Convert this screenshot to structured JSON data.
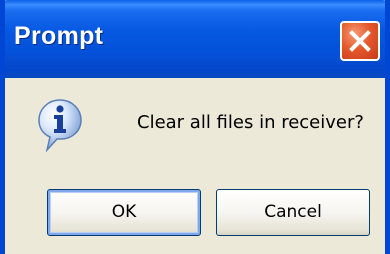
{
  "window": {
    "title": "Prompt",
    "close_icon": "close-icon"
  },
  "dialog": {
    "icon": "info-icon",
    "message": "Clear all files in receiver?",
    "ok_label": "OK",
    "cancel_label": "Cancel"
  },
  "colors": {
    "titlebar": "#0558e0",
    "frame": "#0046d5",
    "body": "#ece9d8",
    "close_button": "#e5592c"
  }
}
